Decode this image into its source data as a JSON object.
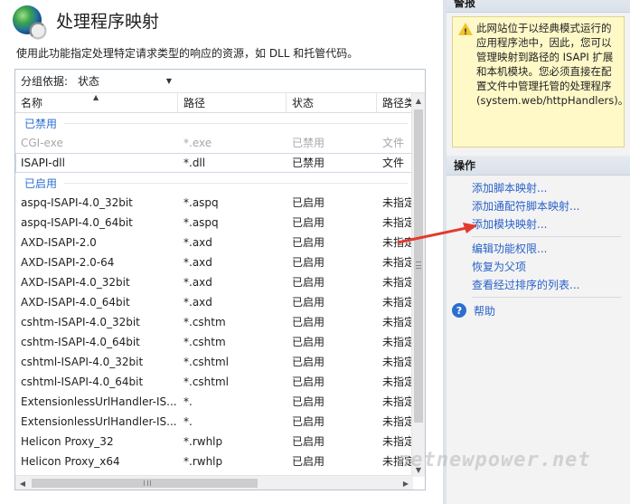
{
  "header": {
    "title": "处理程序映射",
    "description": "使用此功能指定处理特定请求类型的响应的资源，如 DLL 和托管代码。"
  },
  "groupby": {
    "label": "分组依据:",
    "value": "状态"
  },
  "columns": [
    "名称",
    "路径",
    "状态",
    "路径类"
  ],
  "groups": [
    {
      "label": "已禁用",
      "rows": [
        {
          "name": "CGI-exe",
          "path": "*.exe",
          "status": "已禁用",
          "type": "文件",
          "disabled": true
        },
        {
          "name": "ISAPI-dll",
          "path": "*.dll",
          "status": "已禁用",
          "type": "文件",
          "selected": true
        }
      ]
    },
    {
      "label": "已启用",
      "rows": [
        {
          "name": "aspq-ISAPI-4.0_32bit",
          "path": "*.aspq",
          "status": "已启用",
          "type": "未指定"
        },
        {
          "name": "aspq-ISAPI-4.0_64bit",
          "path": "*.aspq",
          "status": "已启用",
          "type": "未指定"
        },
        {
          "name": "AXD-ISAPI-2.0",
          "path": "*.axd",
          "status": "已启用",
          "type": "未指定"
        },
        {
          "name": "AXD-ISAPI-2.0-64",
          "path": "*.axd",
          "status": "已启用",
          "type": "未指定"
        },
        {
          "name": "AXD-ISAPI-4.0_32bit",
          "path": "*.axd",
          "status": "已启用",
          "type": "未指定"
        },
        {
          "name": "AXD-ISAPI-4.0_64bit",
          "path": "*.axd",
          "status": "已启用",
          "type": "未指定"
        },
        {
          "name": "cshtm-ISAPI-4.0_32bit",
          "path": "*.cshtm",
          "status": "已启用",
          "type": "未指定"
        },
        {
          "name": "cshtm-ISAPI-4.0_64bit",
          "path": "*.cshtm",
          "status": "已启用",
          "type": "未指定"
        },
        {
          "name": "cshtml-ISAPI-4.0_32bit",
          "path": "*.cshtml",
          "status": "已启用",
          "type": "未指定"
        },
        {
          "name": "cshtml-ISAPI-4.0_64bit",
          "path": "*.cshtml",
          "status": "已启用",
          "type": "未指定"
        },
        {
          "name": "ExtensionlessUrlHandler-IS...",
          "path": "*.",
          "status": "已启用",
          "type": "未指定"
        },
        {
          "name": "ExtensionlessUrlHandler-IS...",
          "path": "*.",
          "status": "已启用",
          "type": "未指定"
        },
        {
          "name": "Helicon Proxy_32",
          "path": "*.rwhlp",
          "status": "已启用",
          "type": "未指定"
        },
        {
          "name": "Helicon Proxy_x64",
          "path": "*.rwhlp",
          "status": "已启用",
          "type": "未指定"
        }
      ]
    }
  ],
  "alerts": {
    "heading": "警报",
    "message": "此网站位于以经典模式运行的应用程序池中，因此，您可以管理映射到路径的 ISAPI 扩展和本机模块。您必须直接在配置文件中管理托管的处理程序(system.web/httpHandlers)。"
  },
  "actions": {
    "heading": "操作",
    "group1": [
      "添加脚本映射...",
      "添加通配符脚本映射...",
      "添加模块映射..."
    ],
    "group2": [
      "编辑功能权限...",
      "恢复为父项",
      "查看经过排序的列表..."
    ],
    "help": "帮助"
  },
  "watermark": "netnewpower.net",
  "colors": {
    "link": "#2a62c9",
    "group": "#2e6fd1",
    "alert_bg": "#fff9c8",
    "arrow": "#e23b2e"
  }
}
